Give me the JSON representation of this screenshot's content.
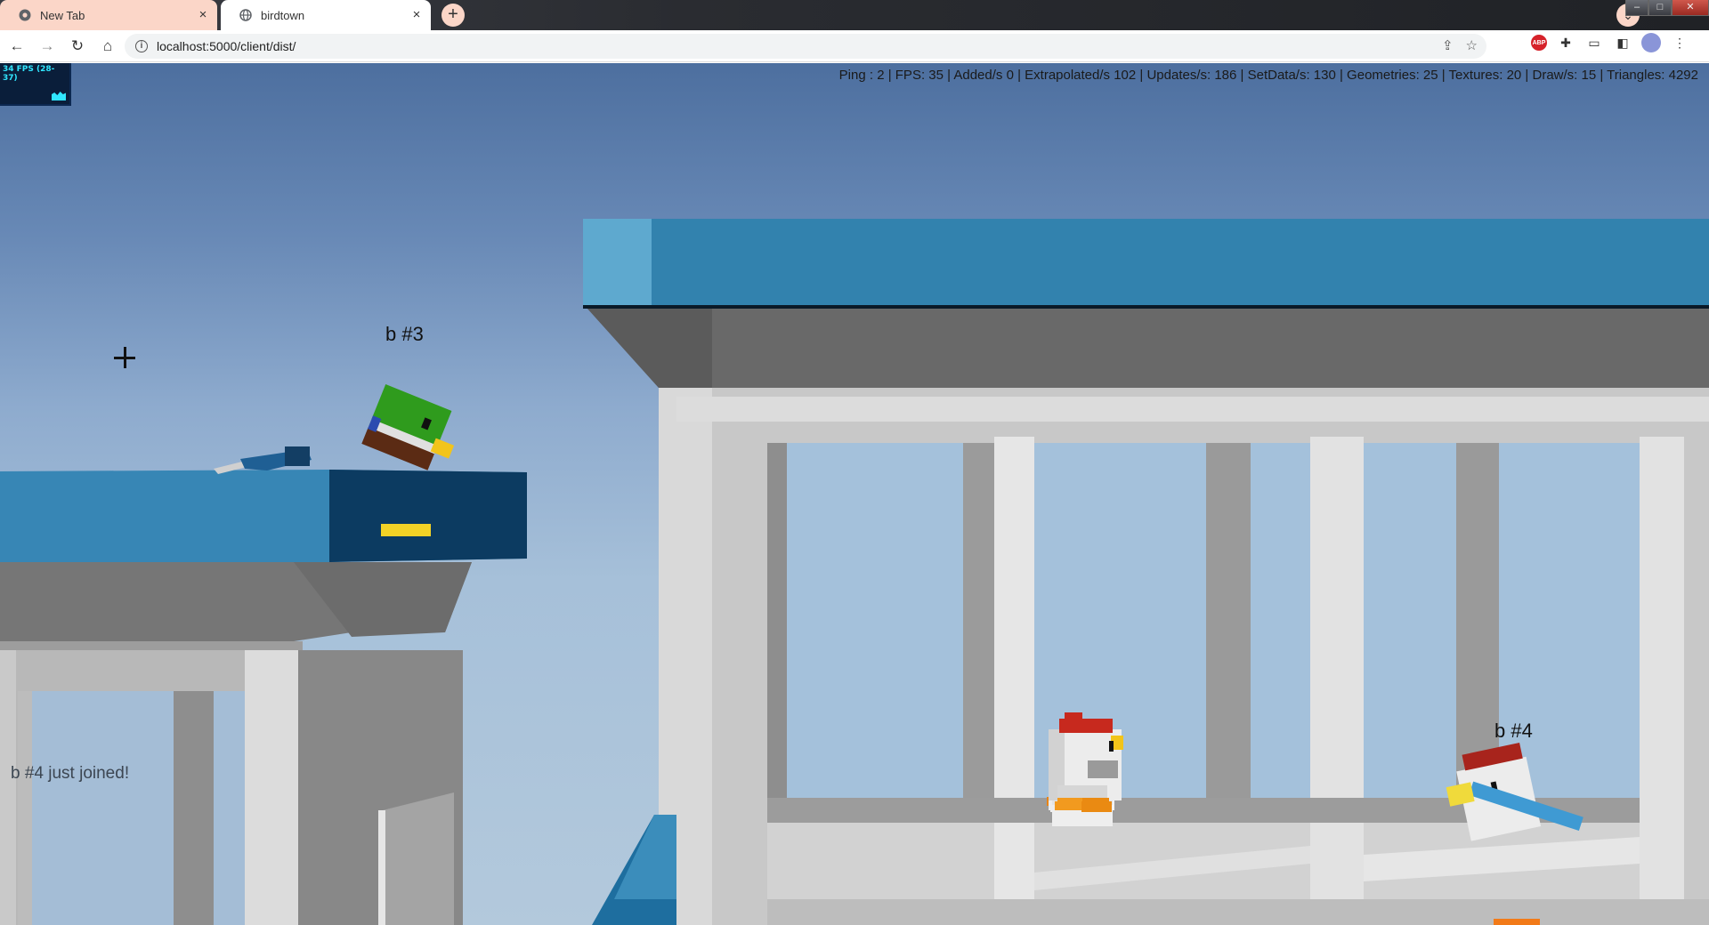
{
  "browser": {
    "tabs": [
      {
        "title": "New Tab",
        "active": false
      },
      {
        "title": "birdtown",
        "active": true
      }
    ],
    "new_tab_symbol": "+",
    "close_symbol": "×",
    "url": "localhost:5000/client/dist/",
    "nav": {
      "back": "←",
      "forward": "→",
      "reload": "↻",
      "home": "⌂"
    },
    "extensions": [
      "share-icon",
      "star-icon",
      "adblock-icon",
      "puzzle-icon",
      "cast-icon",
      "sidepanel-icon",
      "avatar-icon",
      "menu-icon"
    ],
    "abp_label": "ABP",
    "window_controls": [
      "–",
      "□",
      "✕"
    ]
  },
  "game": {
    "fps_meter": "34 FPS (28-37)",
    "stats": "Ping : 2 | FPS: 35 | Added/s 0 | Extrapolated/s 102 | Updates/s: 186 | SetData/s: 130 | Geometries: 25 | Textures: 20 | Draw/s: 15 | Triangles: 4292",
    "players": [
      {
        "name": "b #3",
        "species": "duck",
        "body_color": "#2c8a1a",
        "has_name_tag": true
      },
      {
        "name": "b #4",
        "species": "chicken",
        "body_color": "#e6e6e6",
        "has_name_tag": true
      },
      {
        "species": "chicken",
        "body_color": "#e6e6e6",
        "has_name_tag": false
      }
    ],
    "chat_message": "b #4 just joined!",
    "colors": {
      "sky_top": "#4d6f9f",
      "sky_bottom": "#b3c9dc",
      "platform_blue": "#2f86b3",
      "wall_gray": "#c9c9c9"
    }
  }
}
